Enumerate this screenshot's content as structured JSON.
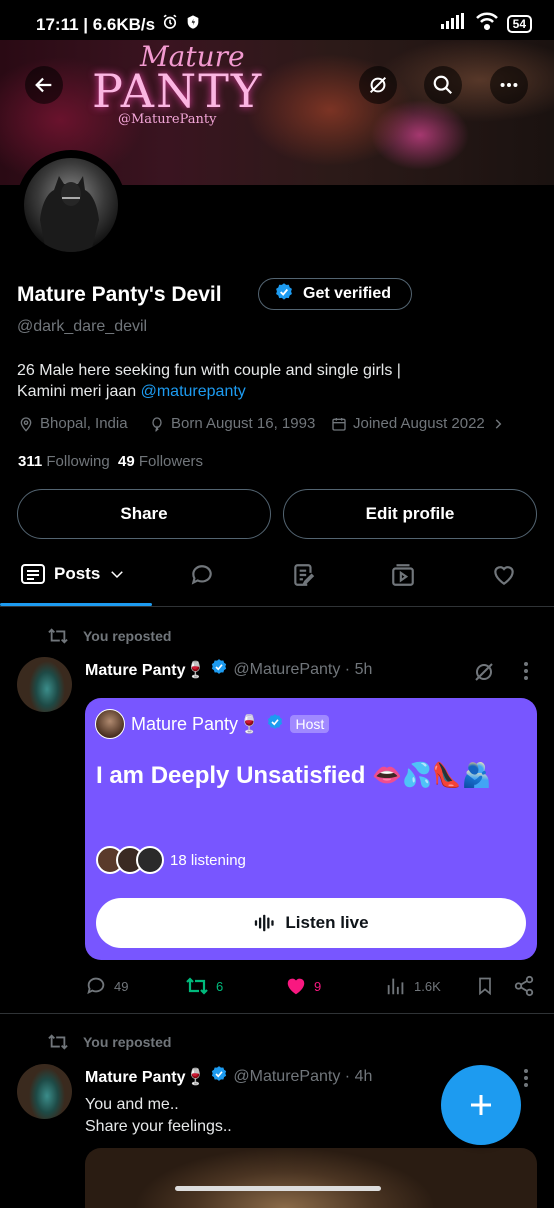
{
  "status_bar": {
    "time_speed": "17:11 | 6.6KB/s",
    "battery": "54"
  },
  "banner": {
    "logo_top": "Mature",
    "logo_main": "PANTY",
    "logo_handle": "@MaturePanty"
  },
  "profile": {
    "name": "Mature Panty's Devil",
    "get_verified": "Get verified",
    "handle": "@dark_dare_devil",
    "bio_line1": "26 Male here seeking fun with couple and single girls |",
    "bio_line2_prefix": "Kamini meri jaan ",
    "bio_link": "@maturepanty",
    "location": "Bhopal, India",
    "born": "Born August 16, 1993",
    "joined": "Joined August 2022",
    "following_count": "311",
    "following_label": "Following",
    "followers_count": "49",
    "followers_label": "Followers",
    "share_label": "Share",
    "edit_label": "Edit profile"
  },
  "tabs": {
    "posts": "Posts"
  },
  "posts": [
    {
      "repost_label": "You reposted",
      "author": "Mature Panty🍷",
      "handle_time": "@MaturePanty · 5h",
      "space": {
        "host_name": "Mature Panty🍷",
        "host_badge": "Host",
        "title": "I am Deeply Unsatisfied 👄💦👠🫂",
        "listening": "18 listening",
        "listen_btn": "Listen live"
      },
      "replies": "49",
      "reposts": "6",
      "likes": "9",
      "views": "1.6K"
    },
    {
      "repost_label": "You reposted",
      "author": "Mature Panty🍷",
      "handle_time": "@MaturePanty · 4h",
      "text_line1": "You and me..",
      "text_line2": "Share your feelings.."
    }
  ],
  "colors": {
    "accent": "#1d9bf0",
    "space_bg": "#7856ff",
    "repost_green": "#00ba7c",
    "like_pink": "#f91880"
  }
}
